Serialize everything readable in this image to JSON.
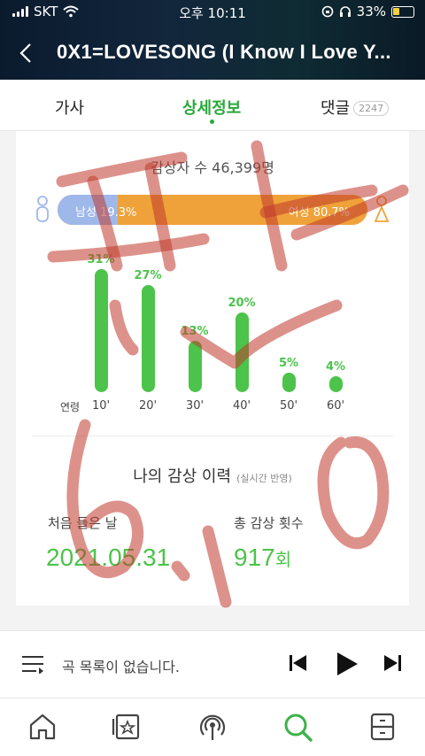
{
  "status": {
    "carrier": "SKT",
    "time": "오후 10:11",
    "battery_pct": "33%",
    "battery_level": 0.33
  },
  "header": {
    "song_title": "0X1=LOVESONG (I Know I Love Y..."
  },
  "tabs": [
    {
      "label": "가사",
      "active": false
    },
    {
      "label": "상세정보",
      "active": true
    },
    {
      "label": "댓글",
      "badge": "2247",
      "active": false
    }
  ],
  "stats": {
    "listeners_label": "감상자 수 46,399명",
    "male_label": "남성 19.3%",
    "female_label": "여성 80.7%",
    "male_ratio": 0.193,
    "age_axis_label": "연령",
    "ages": [
      {
        "age": "10'",
        "pct_label": "31%",
        "value": 31
      },
      {
        "age": "20'",
        "pct_label": "27%",
        "value": 27
      },
      {
        "age": "30'",
        "pct_label": "13%",
        "value": 13
      },
      {
        "age": "40'",
        "pct_label": "20%",
        "value": 20
      },
      {
        "age": "50'",
        "pct_label": "5%",
        "value": 5
      },
      {
        "age": "60'",
        "pct_label": "4%",
        "value": 4
      }
    ]
  },
  "history": {
    "title": "나의 감상 이력",
    "subtitle": "(실시간 반영)",
    "first_listen_label": "처음 들은 날",
    "first_listen_value": "2021.05.31",
    "total_count_label": "총 감상 횟수",
    "total_count_value": "917",
    "total_count_unit": "회"
  },
  "player": {
    "empty_message": "곡 목록이 없습니다."
  },
  "colors": {
    "accent": "#4cc34a",
    "male": "#9fb8ea",
    "female": "#f0a23a",
    "scribble": "#c0392b"
  },
  "icons": [
    "wifi-icon",
    "back-chevron-icon",
    "male-icon",
    "female-icon",
    "playlist-icon",
    "previous-icon",
    "play-icon",
    "next-icon",
    "home-icon",
    "library-icon",
    "podcast-icon",
    "search-icon",
    "menu-icon"
  ]
}
